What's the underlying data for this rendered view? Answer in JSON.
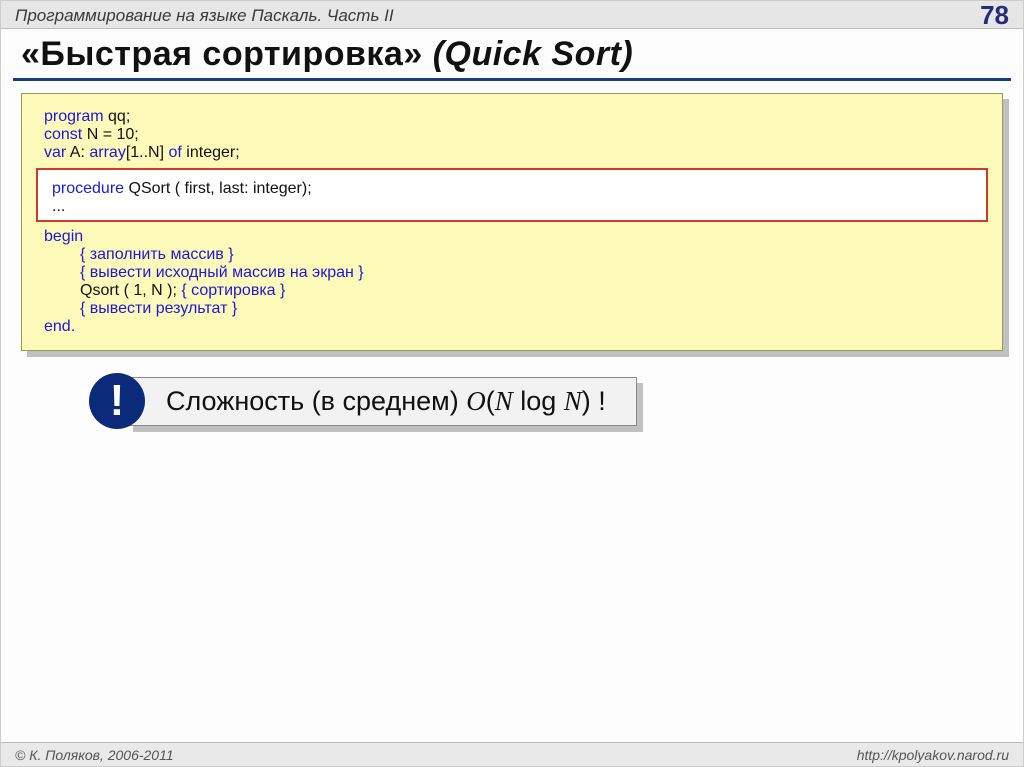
{
  "header": {
    "course_title": "Программирование на языке Паскаль. Часть II",
    "page_number": "78"
  },
  "title": {
    "quoted": "«Быстрая сортировка»",
    "paren": "(Quick Sort)"
  },
  "code": {
    "l1a": "program",
    "l1b": " qq;",
    "l2a": "const",
    "l2b": " N = 10;",
    "l3a": "var",
    "l3b": " A: ",
    "l3c": "array",
    "l3d": "[1..N] ",
    "l3e": "of",
    "l3f": " integer;",
    "inset_l1a": "procedure",
    "inset_l1b": " QSort ( first, last: integer);",
    "inset_l2": "...",
    "l4": "begin",
    "l5": "{ заполнить массив }",
    "l6": "{ вывести исходный массив на экран }",
    "l7a": "Qsort ( 1, N ); ",
    "l7b": "{ сортировка }",
    "l8": "{ вывести результат }",
    "l9": "end."
  },
  "bang": "!",
  "complexity": {
    "label": "Сложность (в среднем) ",
    "bigO_open": "O",
    "paren_open": "(",
    "n1": "N",
    "log": " log ",
    "n2": "N",
    "paren_close": ")",
    "tail": " !"
  },
  "footer": {
    "copyright": "© К. Поляков, 2006-2011",
    "url": "http://kpolyakov.narod.ru"
  }
}
